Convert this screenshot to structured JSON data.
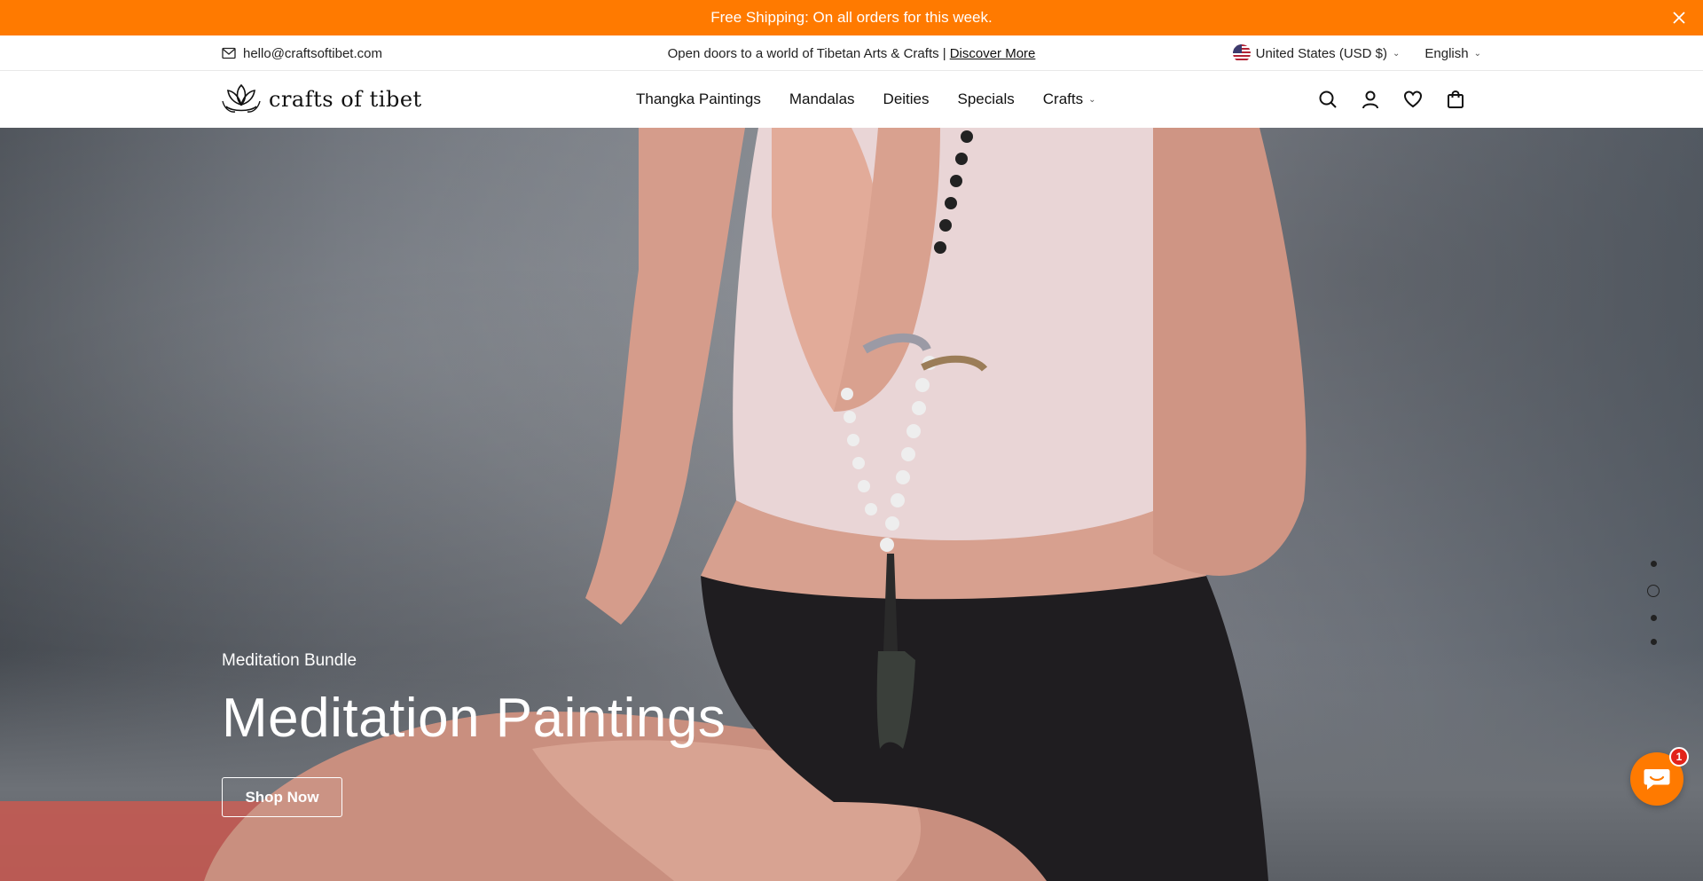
{
  "announcement": {
    "text": "Free Shipping: On all orders for this week.",
    "bg": "#ff7a00"
  },
  "topbar": {
    "email": "hello@craftsoftibet.com",
    "tagline": "Open doors to a world of Tibetan Arts & Crafts |",
    "tagline_link": "Discover More",
    "currency": "United States (USD $)",
    "language": "English"
  },
  "header": {
    "logo_text": "crafts of tibet",
    "nav": [
      {
        "label": "Thangka Paintings"
      },
      {
        "label": "Mandalas"
      },
      {
        "label": "Deities"
      },
      {
        "label": "Specials"
      },
      {
        "label": "Crafts"
      }
    ],
    "icons": [
      "search-icon",
      "account-icon",
      "heart-icon",
      "cart-icon"
    ]
  },
  "hero": {
    "subtitle": "Meditation Bundle",
    "title": "Meditation Paintings",
    "button": "Shop Now",
    "slides": {
      "count": 4,
      "active": 2
    }
  },
  "chat": {
    "badge": "1",
    "color": "#ff7a00"
  }
}
